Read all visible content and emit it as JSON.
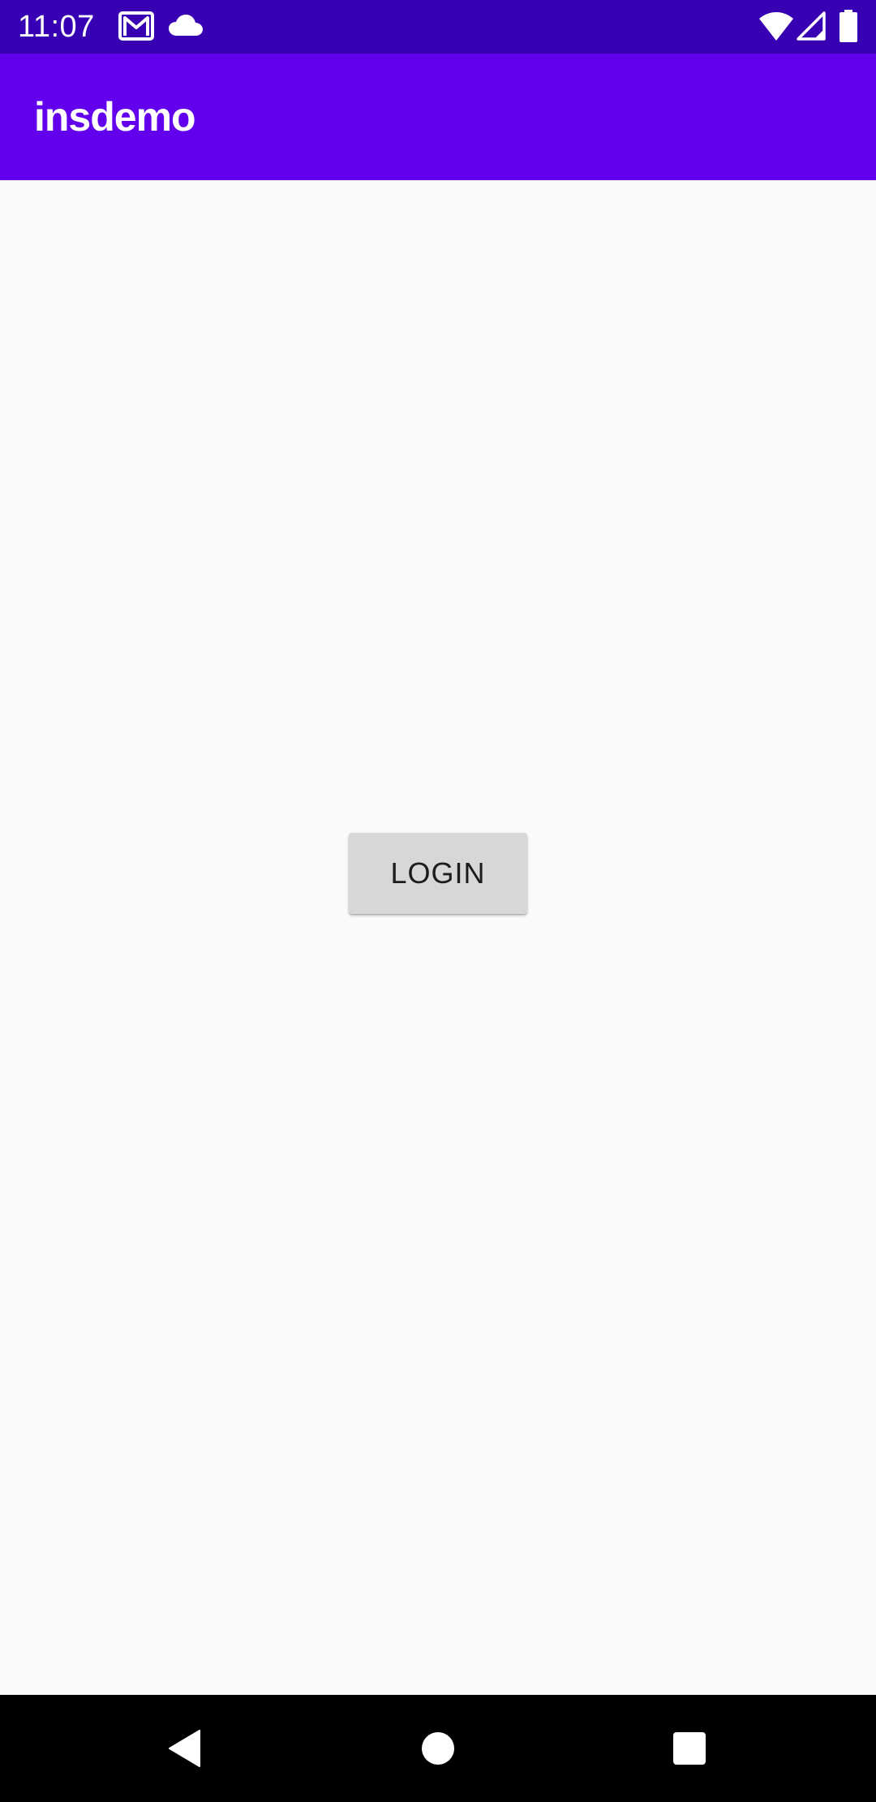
{
  "status_bar": {
    "time": "11:07",
    "background_color": "#3700b3",
    "left_icons": [
      "gmail-icon",
      "cloud-icon"
    ],
    "right_icons": [
      "wifi-icon",
      "signal-icon",
      "battery-icon"
    ]
  },
  "app_bar": {
    "title": "insdemo",
    "background_color": "#6200ee"
  },
  "main": {
    "background_color": "#fafafa",
    "login_button_label": "LOGIN",
    "login_button_color": "#d6d7d7"
  },
  "nav_bar": {
    "background_color": "#000000",
    "buttons": [
      "back-icon",
      "home-icon",
      "recents-icon"
    ]
  }
}
